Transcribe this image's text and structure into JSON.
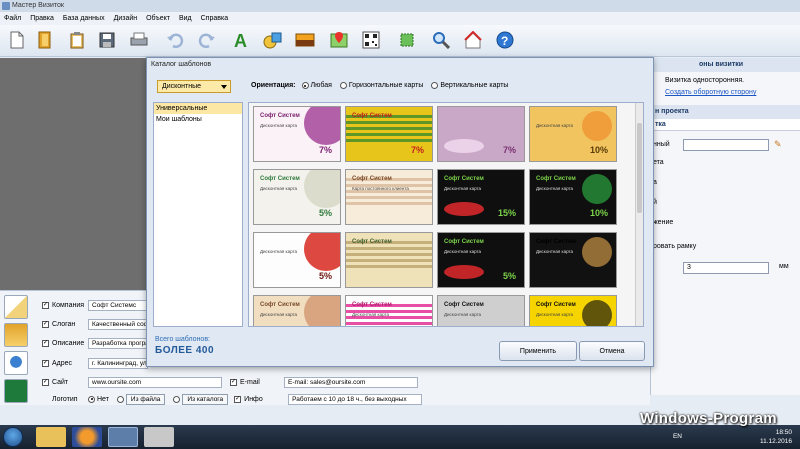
{
  "window": {
    "title": "Мастер Визиток"
  },
  "menu": [
    "Файл",
    "Правка",
    "База данных",
    "Дизайн",
    "Объект",
    "Вид",
    "Справка"
  ],
  "toolbar_icons": [
    "new-document-icon",
    "open-folder-icon",
    "clipboard-icon",
    "save-icon",
    "print-icon",
    "undo-icon",
    "redo-icon",
    "text-icon",
    "shapes-icon",
    "image-icon",
    "map-icon",
    "qr-code-icon",
    "crop-icon",
    "search-icon",
    "home-icon",
    "help-icon"
  ],
  "right_panel": {
    "header": "оны визитки",
    "line1": "Визитка односторонняя.",
    "link": "Создать оборотную сторону",
    "section2": "н проекта",
    "tab": "тка",
    "rows": [
      "нный",
      "ета",
      "а",
      "й",
      "жение"
    ],
    "frame": "ровать рамку",
    "spin_value": "3",
    "unit": "мм"
  },
  "fields": [
    {
      "label": "Компания",
      "value": "Софт Системс"
    },
    {
      "label": "Слоган",
      "value": "Качественный соф"
    },
    {
      "label": "Описание",
      "value": "Разработка програ"
    },
    {
      "label": "Адрес",
      "value": "г. Калининград, ул"
    },
    {
      "label": "Сайт",
      "value": "www.oursite.com"
    }
  ],
  "email": {
    "label": "E-mail",
    "value": "E-mail: sales@oursite.com"
  },
  "info": {
    "label": "Инфо",
    "value": "Работаем с 10 до 18 ч., без выходных"
  },
  "logo": {
    "label": "Логотип",
    "none": "Нет",
    "from_file": "Из файла",
    "from_catalog": "Из каталога"
  },
  "dialog": {
    "title": "Каталог шаблонов",
    "combo": "Дисконтные",
    "orientation_label": "Ориентация:",
    "orientations": [
      "Любая",
      "Горизонтальные карты",
      "Вертикальные карты"
    ],
    "categories": [
      "Универсальные",
      "Мои шаблоны"
    ],
    "total_label": "Всего шаблонов:",
    "total_value": "БОЛЕЕ 400",
    "apply": "Применить",
    "cancel": "Отмена",
    "cards": [
      {
        "name": "Софт Систем",
        "sub": "Дисконтная карта",
        "pct": "7%",
        "bg": "#fbf2f8",
        "accent": "#a5469a",
        "nc": "#7a1e6e"
      },
      {
        "name": "Софт Систем",
        "sub": "",
        "pct": "7%",
        "bg": "#e8c51a",
        "accent": "#3c8a2c",
        "nc": "#c0211b"
      },
      {
        "name": "",
        "sub": "",
        "pct": "7%",
        "bg": "#c9a8c7",
        "accent": "#efd6ec",
        "nc": "#7a2f72"
      },
      {
        "name": "",
        "sub": "Дисконтная карта",
        "pct": "10%",
        "bg": "#f1c45f",
        "accent": "#f08a2a",
        "nc": "#5a3a08"
      },
      {
        "name": "Софт Систем",
        "sub": "Дисконтная карта",
        "pct": "5%",
        "bg": "#f4f2ec",
        "accent": "#d7d8c8",
        "nc": "#2e7a3b"
      },
      {
        "name": "Софт Систем",
        "sub": "Карта постоянного клиента",
        "pct": "",
        "bg": "#f7ecd9",
        "accent": "#d9b99a",
        "nc": "#7b4a2a"
      },
      {
        "name": "Софт Систем",
        "sub": "Дисконтная карта",
        "pct": "15%",
        "bg": "#0f0f0f",
        "accent": "#d6282a",
        "nc": "#7cd44a"
      },
      {
        "name": "Софт Систем",
        "sub": "Дисконтная карта",
        "pct": "10%",
        "bg": "#0f0f0f",
        "accent": "#2db043",
        "nc": "#7cd44a"
      },
      {
        "name": "",
        "sub": "Дисконтная карта",
        "pct": "5%",
        "bg": "#fdfdfd",
        "accent": "#d7281e",
        "nc": "#6d1510"
      },
      {
        "name": "Софт Систем",
        "sub": "",
        "pct": "",
        "bg": "#efe1b8",
        "accent": "#bba36a",
        "nc": "#3f5e2f"
      },
      {
        "name": "Софт Систем",
        "sub": "Дисконтная карта",
        "pct": "5%",
        "bg": "#0f0f0f",
        "accent": "#d6282a",
        "nc": "#7cd44a"
      },
      {
        "name": "Софт Систем",
        "sub": "Дисконтная карта",
        "pct": "",
        "bg": "#111",
        "accent": "#d8a04a",
        "nc": "#000"
      },
      {
        "name": "Софт Систем",
        "sub": "Дисконтная карта",
        "pct": "",
        "bg": "#f1ddc0",
        "accent": "#d49b74",
        "nc": "#7a4a2a"
      },
      {
        "name": "Софт Систем",
        "sub": "Дисконтная карта",
        "pct": "",
        "bg": "#fdfdfd",
        "accent": "#e2238e",
        "nc": "#b31c6e"
      },
      {
        "name": "Софт Систем",
        "sub": "Дисконтная карта",
        "pct": "",
        "bg": "#cfcfcf",
        "accent": "#e8e8e8",
        "nc": "#111"
      },
      {
        "name": "Софт Систем",
        "sub": "Дисконтная карта",
        "pct": "",
        "bg": "#f5d400",
        "accent": "#111",
        "nc": "#111"
      }
    ]
  },
  "taskbar": {
    "lang": "EN",
    "time": "18:50",
    "date": "11.12.2016"
  },
  "watermark": "Windows-Program"
}
